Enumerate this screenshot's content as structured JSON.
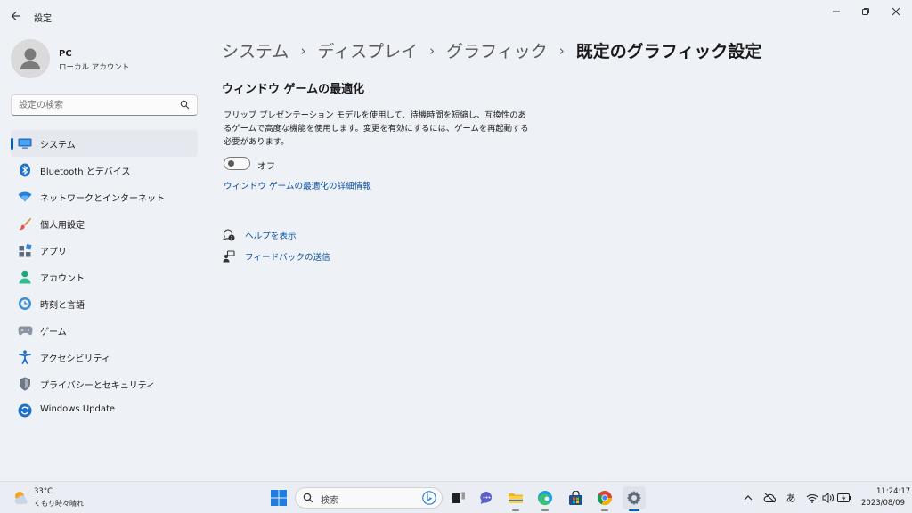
{
  "window": {
    "title": "設定"
  },
  "user": {
    "name": "PC",
    "account_type": "ローカル アカウント"
  },
  "search": {
    "placeholder": "設定の検索"
  },
  "sidebar": {
    "items": [
      {
        "label": "システム",
        "icon": "display-icon",
        "active": true
      },
      {
        "label": "Bluetooth とデバイス",
        "icon": "bluetooth-icon"
      },
      {
        "label": "ネットワークとインターネット",
        "icon": "wifi-icon"
      },
      {
        "label": "個人用設定",
        "icon": "brush-icon"
      },
      {
        "label": "アプリ",
        "icon": "apps-icon"
      },
      {
        "label": "アカウント",
        "icon": "person-icon"
      },
      {
        "label": "時刻と言語",
        "icon": "clock-globe-icon"
      },
      {
        "label": "ゲーム",
        "icon": "gamepad-icon"
      },
      {
        "label": "アクセシビリティ",
        "icon": "accessibility-icon"
      },
      {
        "label": "プライバシーとセキュリティ",
        "icon": "shield-icon"
      },
      {
        "label": "Windows Update",
        "icon": "update-icon"
      }
    ]
  },
  "breadcrumb": [
    "システム",
    "ディスプレイ",
    "グラフィック",
    "既定のグラフィック設定"
  ],
  "main": {
    "section_title": "ウィンドウ ゲームの最適化",
    "description": "フリップ プレゼンテーション モデルを使用して、待機時間を短縮し、互換性のあるゲームで高度な機能を使用します。変更を有効にするには、ゲームを再起動する必要があります。",
    "toggle": {
      "state_label": "オフ",
      "on": false
    },
    "detail_link": "ウィンドウ ゲームの最適化の詳細情報",
    "help_link": "ヘルプを表示",
    "feedback_link": "フィードバックの送信"
  },
  "taskbar": {
    "weather": {
      "temp": "33°C",
      "desc": "くもり時々晴れ"
    },
    "search_label": "検索",
    "apps": [
      "file-explorer-icon",
      "edge-icon",
      "store-icon",
      "chrome-icon",
      "settings-icon"
    ],
    "tray": {
      "ime": "あ"
    },
    "clock": {
      "time": "11:24:17",
      "date": "2023/08/09"
    }
  },
  "colors": {
    "accent": "#005fb8",
    "link": "#0b4fa0",
    "window_bg": "#eef1f6"
  }
}
